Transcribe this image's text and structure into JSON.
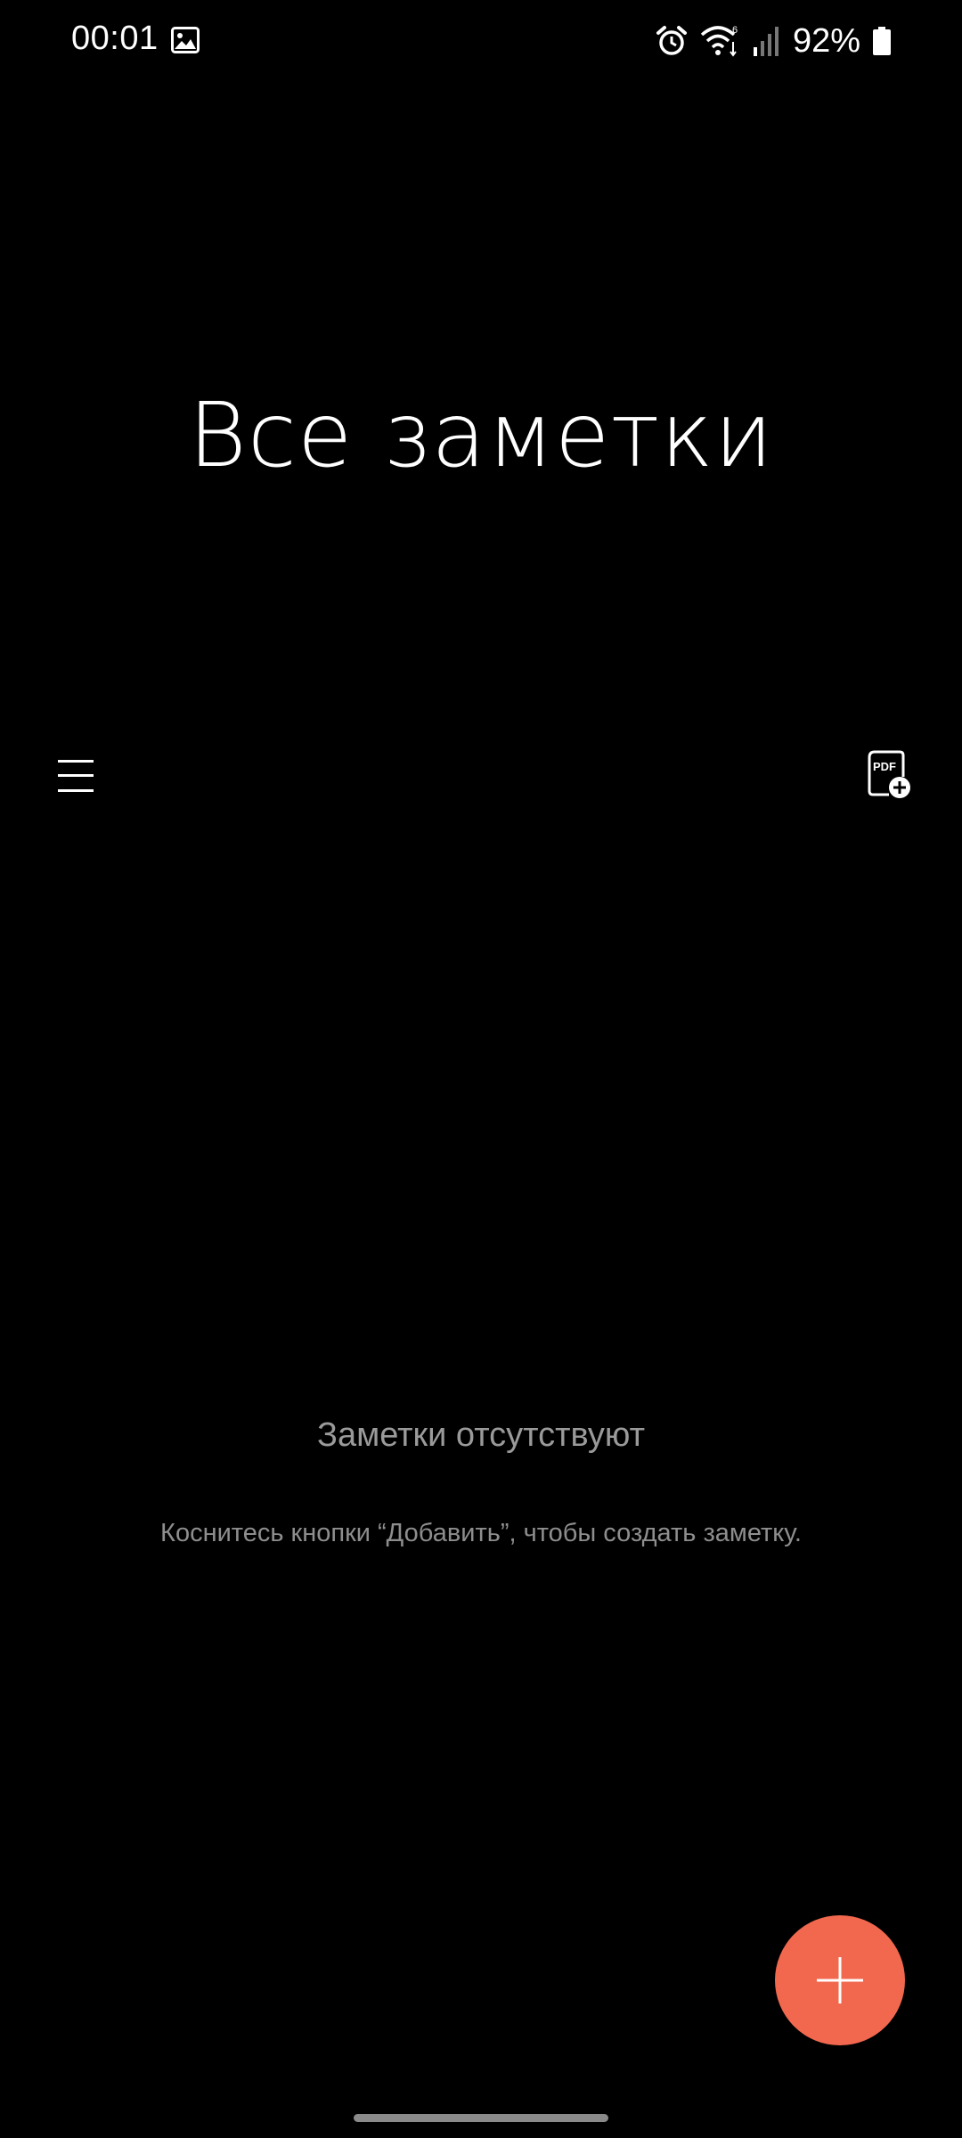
{
  "status_bar": {
    "time": "00:01",
    "battery": "92%",
    "icons": [
      "gallery-icon",
      "alarm-icon",
      "wifi-icon",
      "signal-icon",
      "battery-icon"
    ]
  },
  "header": {
    "title": "Все заметки"
  },
  "toolbar": {
    "menu_icon": "menu-icon",
    "pdf_icon": "pdf-import-icon",
    "pdf_icon_text": "PDF"
  },
  "empty_state": {
    "title": "Заметки отсутствуют",
    "hint": "Коснитесь кнопки “Добавить”, чтобы создать заметку."
  },
  "fab": {
    "icon": "plus-icon",
    "color": "#f2684f"
  }
}
